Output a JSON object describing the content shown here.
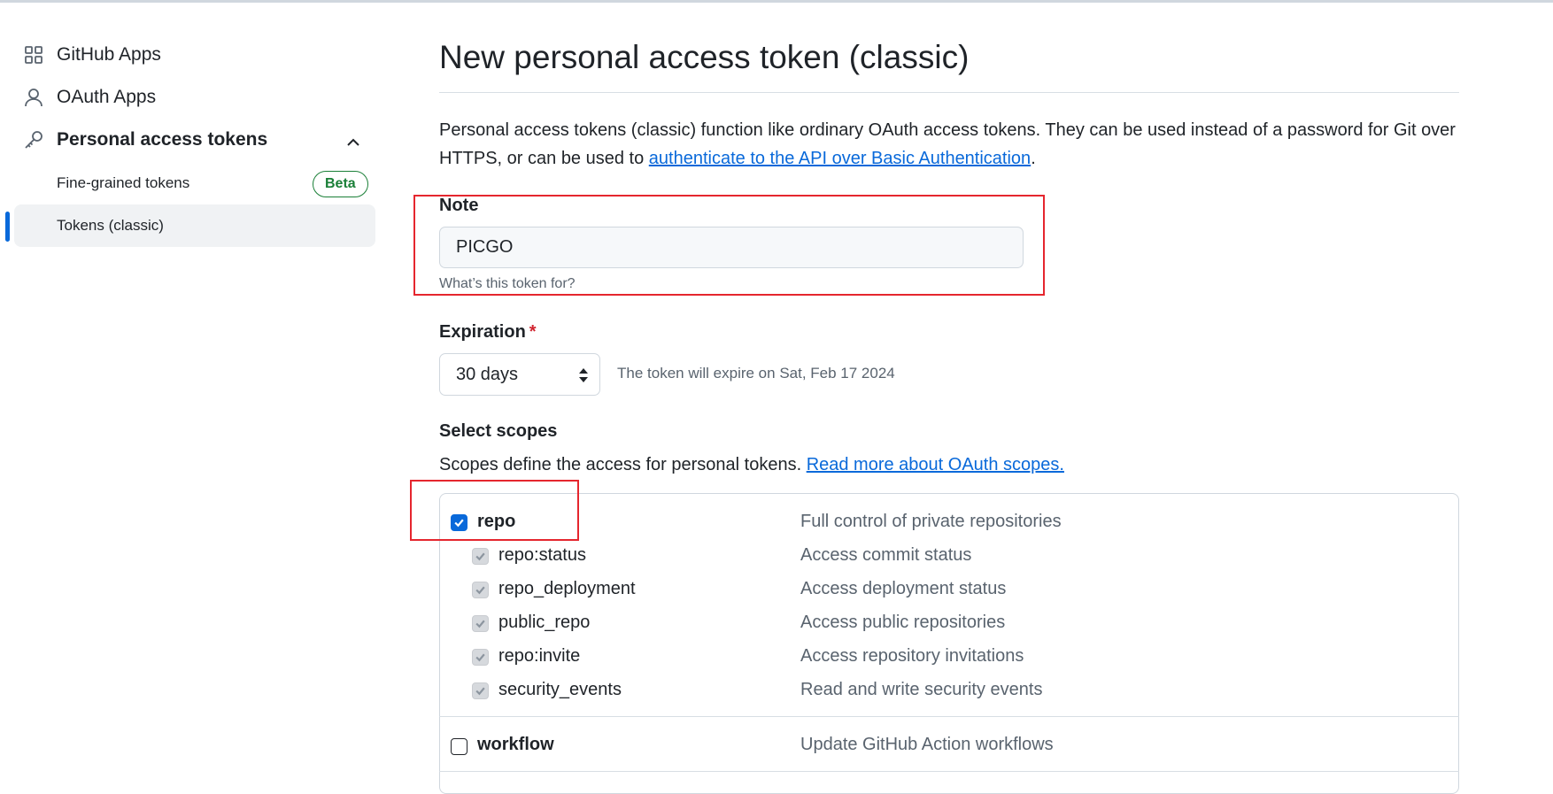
{
  "sidebar": {
    "items": [
      {
        "label": "GitHub Apps",
        "icon": "apps-grid-icon"
      },
      {
        "label": "OAuth Apps",
        "icon": "person-icon"
      },
      {
        "label": "Personal access tokens",
        "icon": "key-icon"
      }
    ],
    "sub_items": [
      {
        "label": "Fine-grained tokens",
        "badge": "Beta"
      },
      {
        "label": "Tokens (classic)",
        "selected": true
      }
    ]
  },
  "main": {
    "title": "New personal access token (classic)",
    "intro_text": "Personal access tokens (classic) function like ordinary OAuth access tokens. They can be used instead of a password for Git over HTTPS, or can be used to ",
    "intro_link": "authenticate to the API over Basic Authentication",
    "intro_end": ".",
    "note": {
      "label": "Note",
      "value": "PICGO",
      "hint": "What’s this token for?"
    },
    "expiration": {
      "label": "Expiration",
      "required_mark": "*",
      "selected": "30 days",
      "info": "The token will expire on Sat, Feb 17 2024"
    },
    "scopes": {
      "heading": "Select scopes",
      "description": "Scopes define the access for personal tokens. ",
      "link": "Read more about OAuth scopes.",
      "items": [
        {
          "name": "repo",
          "desc": "Full control of private repositories",
          "checked": true
        },
        {
          "name": "repo:status",
          "desc": "Access commit status",
          "checked": true
        },
        {
          "name": "repo_deployment",
          "desc": "Access deployment status",
          "checked": true
        },
        {
          "name": "public_repo",
          "desc": "Access public repositories",
          "checked": true
        },
        {
          "name": "repo:invite",
          "desc": "Access repository invitations",
          "checked": true
        },
        {
          "name": "security_events",
          "desc": "Read and write security events",
          "checked": true
        },
        {
          "name": "workflow",
          "desc": "Update GitHub Action workflows",
          "checked": false
        }
      ]
    }
  },
  "colors": {
    "accent": "#0969da",
    "beta_green": "#1a7f37",
    "highlight_red": "#e5262e"
  }
}
